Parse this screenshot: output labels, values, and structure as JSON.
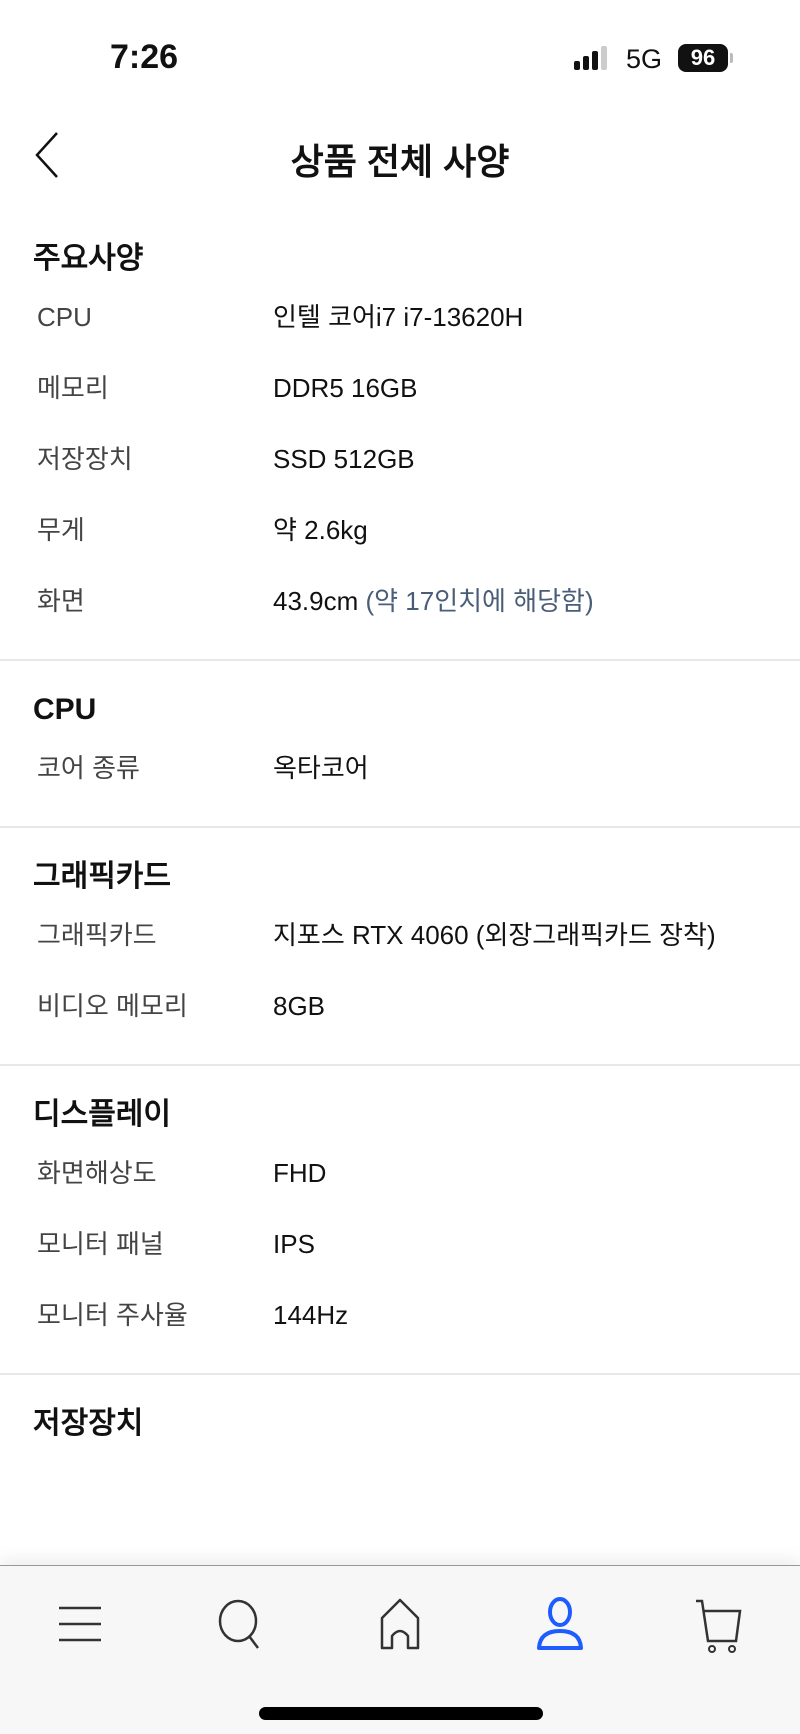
{
  "status_bar": {
    "time": "7:26",
    "network": "5G",
    "battery": "96"
  },
  "header": {
    "title": "상품 전체 사양",
    "back_icon": "chevron-left-icon"
  },
  "sections": [
    {
      "title": "주요사양",
      "rows": [
        {
          "label": "CPU",
          "value": "인텔 코어i7 i7-13620H"
        },
        {
          "label": "메모리",
          "value": "DDR5 16GB"
        },
        {
          "label": "저장장치",
          "value": "SSD 512GB"
        },
        {
          "label": "무게",
          "value": "약 2.6kg"
        },
        {
          "label": "화면",
          "value": "43.9cm",
          "note": "(약 17인치에 해당함)"
        }
      ]
    },
    {
      "title": "CPU",
      "rows": [
        {
          "label": "코어 종류",
          "value": "옥타코어"
        }
      ]
    },
    {
      "title": "그래픽카드",
      "rows": [
        {
          "label": "그래픽카드",
          "value": "지포스 RTX 4060 (외장그래픽카드 장착)"
        },
        {
          "label": "비디오 메모리",
          "value": "8GB"
        }
      ]
    },
    {
      "title": "디스플레이",
      "rows": [
        {
          "label": "화면해상도",
          "value": "FHD"
        },
        {
          "label": "모니터 패널",
          "value": "IPS"
        },
        {
          "label": "모니터 주사율",
          "value": "144Hz"
        }
      ]
    },
    {
      "title": "저장장치",
      "rows": []
    }
  ],
  "tabbar": {
    "items": [
      "menu-icon",
      "search-icon",
      "home-icon",
      "user-icon",
      "cart-icon"
    ],
    "active": "user-icon",
    "active_color": "#1f5cff"
  }
}
